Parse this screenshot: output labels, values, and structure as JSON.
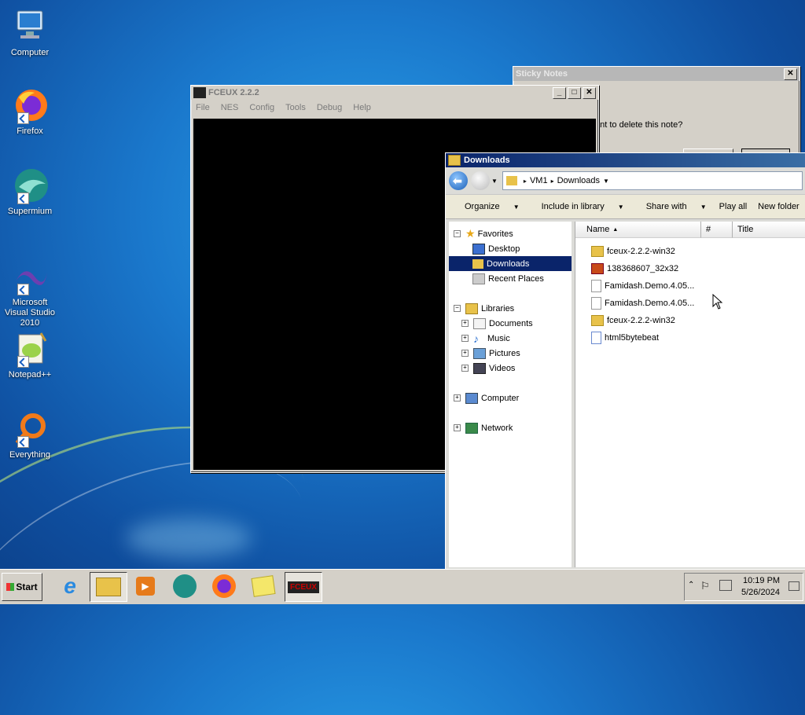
{
  "desktop": {
    "icons": [
      {
        "label": "Computer"
      },
      {
        "label": "Firefox"
      },
      {
        "label": "Supermium"
      },
      {
        "label": "Microsoft Visual Studio 2010"
      },
      {
        "label": "Notepad++"
      },
      {
        "label": "Everything"
      }
    ]
  },
  "sticky": {
    "title": "Sticky Notes",
    "message": "ant to delete this note?"
  },
  "fceux": {
    "title": "FCEUX 2.2.2",
    "menu": [
      "File",
      "NES",
      "Config",
      "Tools",
      "Debug",
      "Help"
    ]
  },
  "explorer": {
    "title": "Downloads",
    "breadcrumb": [
      "VM1",
      "Downloads"
    ],
    "commands": [
      "Organize",
      "Include in library",
      "Share with",
      "Play all",
      "New folder"
    ],
    "tree": {
      "favorites": "Favorites",
      "desktop": "Desktop",
      "downloads": "Downloads",
      "recent": "Recent Places",
      "libraries": "Libraries",
      "documents": "Documents",
      "music": "Music",
      "pictures": "Pictures",
      "videos": "Videos",
      "computer": "Computer",
      "network": "Network"
    },
    "columns": [
      "Name",
      "#",
      "Title"
    ],
    "files": [
      {
        "name": "fceux-2.2.2-win32",
        "icon": "folder-icon"
      },
      {
        "name": "138368607_32x32",
        "icon": "image-file-icon"
      },
      {
        "name": "Famidash.Demo.4.05...",
        "icon": "file-icon"
      },
      {
        "name": "Famidash.Demo.4.05...",
        "icon": "file-icon"
      },
      {
        "name": "fceux-2.2.2-win32",
        "icon": "folder-icon"
      },
      {
        "name": "html5bytebeat",
        "icon": "audio-file-icon"
      }
    ]
  },
  "taskbar": {
    "start": "Start",
    "time": "10:19 PM",
    "date": "5/26/2024",
    "fceux_label": "FCEUX"
  },
  "colors": {
    "selection": "#0a246a",
    "folder": "#e8c24a"
  }
}
